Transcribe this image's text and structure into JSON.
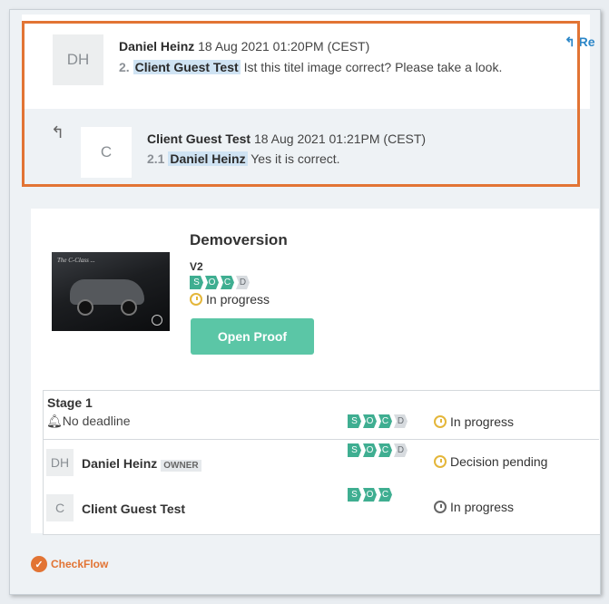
{
  "comments": [
    {
      "avatar": "DH",
      "author": "Daniel Heinz",
      "date": "18 Aug 2021 01:20PM (CEST)",
      "number": "2.",
      "mention": "Client Guest Test",
      "text": "Ist this titel image correct? Please take a look.",
      "reply_label": "Re"
    },
    {
      "avatar": "C",
      "author": "Client Guest Test",
      "date": "18 Aug 2021 01:21PM (CEST)",
      "number": "2.1",
      "mention": "Daniel Heinz",
      "text": "Yes it is correct."
    }
  ],
  "proof": {
    "title": "Demoversion",
    "version": "V2",
    "badges": [
      "S",
      "O",
      "C",
      "D"
    ],
    "status": "In progress",
    "open_button": "Open Proof",
    "thumbnail_caption": "The C-Class ..."
  },
  "stage": {
    "title": "Stage 1",
    "deadline": "No deadline",
    "status": "In progress",
    "badges": [
      "S",
      "O",
      "C",
      "D"
    ],
    "members": [
      {
        "avatar": "DH",
        "name": "Daniel Heinz",
        "role": "OWNER",
        "badges": [
          "S",
          "O",
          "C",
          "D"
        ],
        "status": "Decision pending"
      },
      {
        "avatar": "C",
        "name": "Client Guest Test",
        "role": "",
        "badges": [
          "S",
          "O",
          "C"
        ],
        "status": "In progress"
      }
    ]
  },
  "brand": {
    "name": "CheckFlow"
  },
  "colors": {
    "accent": "#e27434",
    "green": "#3fae91",
    "button": "#5bc6a6",
    "mention_bg": "#cfe3f3",
    "link": "#2c87c8"
  }
}
